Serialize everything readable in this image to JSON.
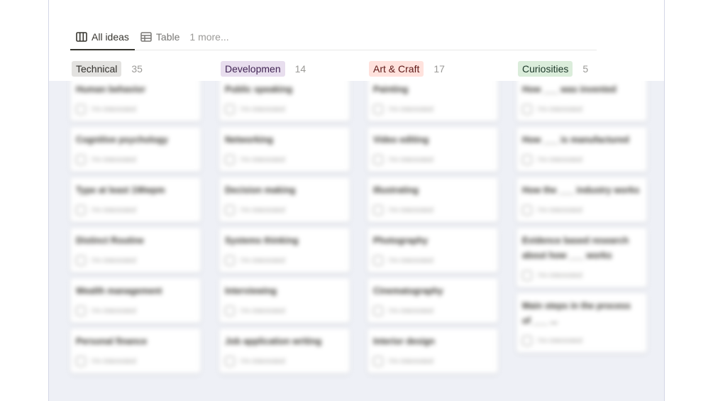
{
  "views": {
    "tabs": [
      {
        "label": "All ideas",
        "icon": "board-icon",
        "active": true
      },
      {
        "label": "Table",
        "icon": "table-icon",
        "active": false
      }
    ],
    "more_label": "1 more..."
  },
  "groups": [
    {
      "label": "Technical",
      "count": "35",
      "bg": "#e3e2e0",
      "fg": "#32302c"
    },
    {
      "label": "Developmen",
      "count": "14",
      "bg": "#e8deee",
      "fg": "#412454"
    },
    {
      "label": "Art & Craft",
      "count": "17",
      "bg": "#ffe2dd",
      "fg": "#5d1715"
    },
    {
      "label": "Curiosities",
      "count": "5",
      "bg": "#dbeddb",
      "fg": "#1c3829"
    }
  ],
  "columns": [
    {
      "cards": [
        {
          "title": "Human behavior",
          "prop": "I'm interested"
        },
        {
          "title": "Cognitive psychology",
          "prop": "I'm interested"
        },
        {
          "title": "Type at least 1Wwpm",
          "prop": "I'm interested"
        },
        {
          "title": "Distinct Routine",
          "prop": "I'm interested"
        },
        {
          "title": "Wealth management",
          "prop": "I'm interested"
        },
        {
          "title": "Personal finance",
          "prop": "I'm interested"
        }
      ]
    },
    {
      "cards": [
        {
          "title": "Public speaking",
          "prop": "I'm interested"
        },
        {
          "title": "Networking",
          "prop": "I'm interested"
        },
        {
          "title": "Decision making",
          "prop": "I'm interested"
        },
        {
          "title": "Systems thinking",
          "prop": "I'm interested"
        },
        {
          "title": "Interviewing",
          "prop": "I'm interested"
        },
        {
          "title": "Job application writing",
          "prop": "I'm interested"
        }
      ]
    },
    {
      "cards": [
        {
          "title": "Painting",
          "prop": "I'm interested"
        },
        {
          "title": "Video editing",
          "prop": "I'm interested"
        },
        {
          "title": "Illustrating",
          "prop": "I'm interested"
        },
        {
          "title": "Photography",
          "prop": "I'm interested"
        },
        {
          "title": "Cinematography",
          "prop": "I'm interested"
        },
        {
          "title": "Interior design",
          "prop": "I'm interested"
        }
      ]
    },
    {
      "cards": [
        {
          "title": "How ___ was invented",
          "prop": "I'm interested"
        },
        {
          "title": "How ___ is manufactured",
          "prop": "I'm interested"
        },
        {
          "title": "How the ___ industry works",
          "prop": "I'm interested"
        },
        {
          "title": "Evidence based research about how ___ works",
          "prop": "I'm interested"
        },
        {
          "title": "Main steps in the process of ___ ...",
          "prop": "I'm interested"
        }
      ]
    }
  ]
}
